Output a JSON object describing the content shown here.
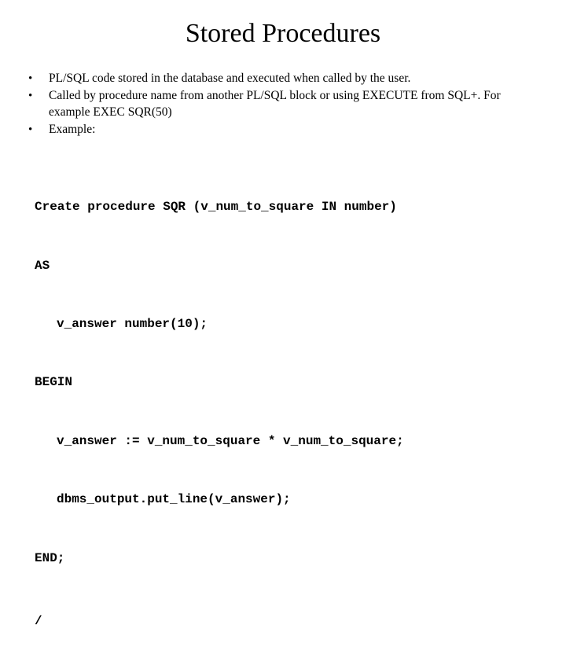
{
  "title": "Stored Procedures",
  "bullets": {
    "b0": "PL/SQL code stored in the database and executed when called by the user.",
    "b1": "Called by procedure name from another PL/SQL block or using EXECUTE from SQL+.  For example   EXEC SQR(50)",
    "b2": "Example:"
  },
  "code": {
    "l0": "Create procedure SQR (v_num_to_square IN number)",
    "l1": "AS",
    "l2": "v_answer number(10);",
    "l3": "BEGIN",
    "l4": "v_answer := v_num_to_square * v_num_to_square;",
    "l5": "dbms_output.put_line(v_answer);",
    "l6": "END;",
    "l7": "/"
  }
}
